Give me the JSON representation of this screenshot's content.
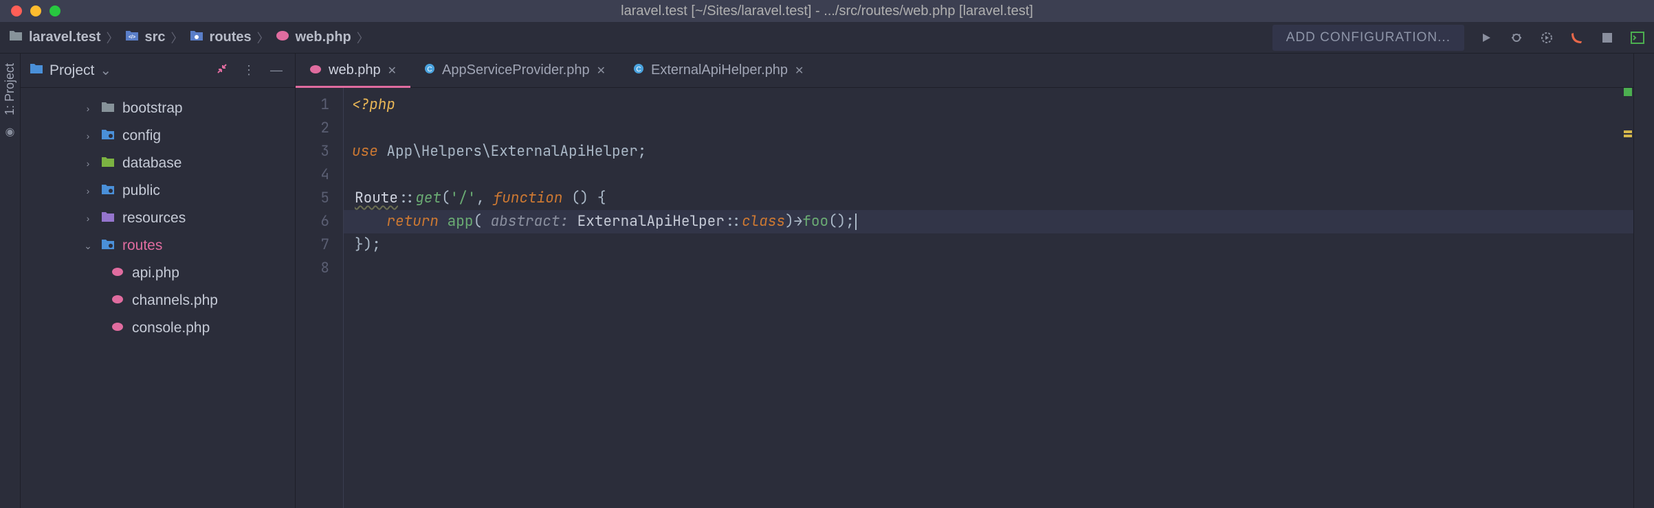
{
  "window": {
    "title": "laravel.test [~/Sites/laravel.test] - .../src/routes/web.php [laravel.test]"
  },
  "breadcrumbs": {
    "items": [
      {
        "label": "laravel.test",
        "icon": "folder"
      },
      {
        "label": "src",
        "icon": "php-folder"
      },
      {
        "label": "routes",
        "icon": "routes-folder"
      },
      {
        "label": "web.php",
        "icon": "elephant"
      }
    ]
  },
  "run_config": {
    "add_label": "ADD CONFIGURATION..."
  },
  "toolbar_icons": [
    "run",
    "debug",
    "coverage",
    "phone",
    "stop",
    "terminal"
  ],
  "left_rail": {
    "label": "1: Project"
  },
  "project_panel": {
    "title": "Project",
    "tree": [
      {
        "label": "bootstrap",
        "icon": "folder-gray",
        "expanded": false,
        "depth": 1
      },
      {
        "label": "config",
        "icon": "folder-blue",
        "expanded": false,
        "depth": 1
      },
      {
        "label": "database",
        "icon": "folder-green",
        "expanded": false,
        "depth": 1
      },
      {
        "label": "public",
        "icon": "folder-teal",
        "expanded": false,
        "depth": 1
      },
      {
        "label": "resources",
        "icon": "folder-purple",
        "expanded": false,
        "depth": 1
      },
      {
        "label": "routes",
        "icon": "folder-teal",
        "expanded": true,
        "depth": 1,
        "active": true
      },
      {
        "label": "api.php",
        "icon": "elephant",
        "depth": 2
      },
      {
        "label": "channels.php",
        "icon": "elephant",
        "depth": 2
      },
      {
        "label": "console.php",
        "icon": "elephant",
        "depth": 2
      }
    ]
  },
  "tabs": [
    {
      "label": "web.php",
      "icon": "elephant",
      "active": true
    },
    {
      "label": "AppServiceProvider.php",
      "icon": "php-class",
      "active": false
    },
    {
      "label": "ExternalApiHelper.php",
      "icon": "php-class",
      "active": false
    }
  ],
  "editor": {
    "filename": "web.php",
    "line_numbers": [
      "1",
      "2",
      "3",
      "4",
      "5",
      "6",
      "7",
      "8"
    ],
    "current_line": 6,
    "code": {
      "l1": {
        "tag_open": "<?php"
      },
      "l3": {
        "use": "use",
        "ns": " App\\Helpers\\ExternalApiHelper;"
      },
      "l5": {
        "class": "Route",
        "sep": "::",
        "method": "get",
        "open": "(",
        "str": "'/'",
        "comma": ", ",
        "fn": "function",
        "paren": " () {"
      },
      "l6": {
        "indent": "    ",
        "ret": "return",
        "sp": " ",
        "app": "app",
        "open": "( ",
        "param": "abstract:",
        "sp2": " ",
        "cls": "ExternalApiHelper",
        "sep": "::",
        "classkw": "class",
        "close": ")",
        "arrow": "→",
        "foo": "foo",
        "call": "();"
      },
      "l7": {
        "close": "});"
      }
    }
  },
  "colors": {
    "bg": "#2b2d3a",
    "accent": "#e06c9f",
    "keyword": "#cc7832",
    "string": "#6aab73"
  }
}
